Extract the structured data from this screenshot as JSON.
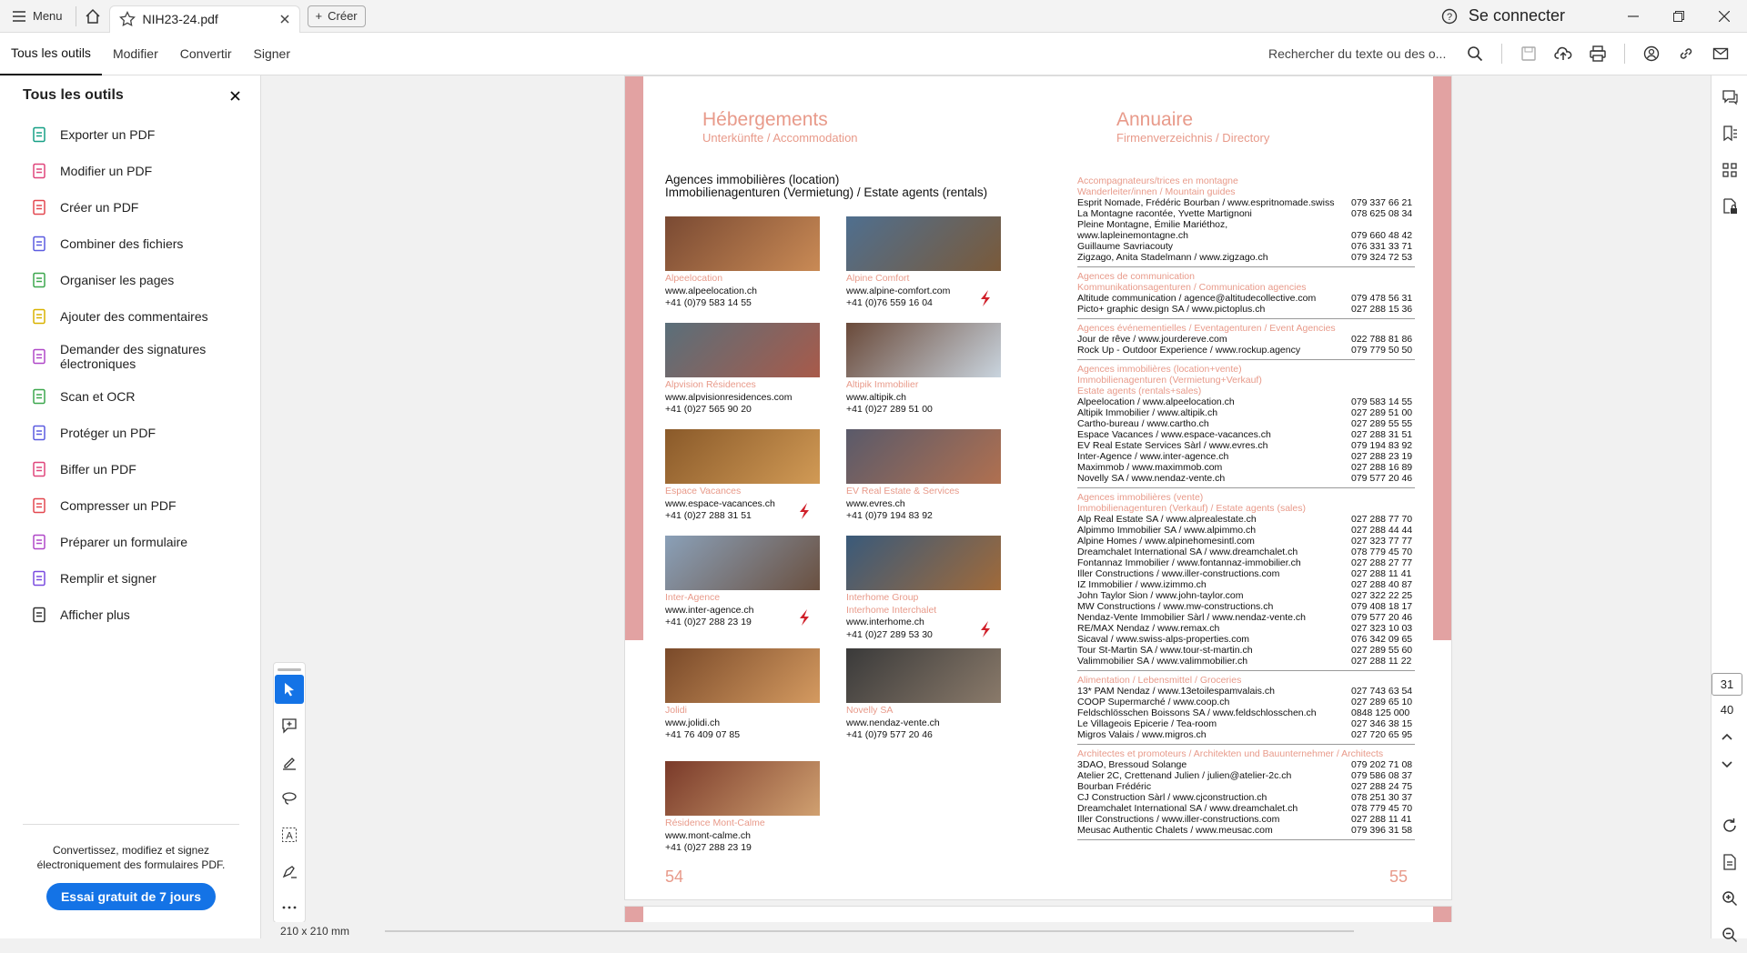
{
  "titlebar": {
    "menu_label": "Menu",
    "tab_title": "NIH23-24.pdf",
    "create_label": "Créer",
    "signin_label": "Se connecter"
  },
  "toolbar": {
    "tabs": [
      "Tous les outils",
      "Modifier",
      "Convertir",
      "Signer"
    ],
    "search_text": "Rechercher du texte ou des o..."
  },
  "left_panel": {
    "title": "Tous les outils",
    "items": [
      {
        "label": "Exporter un PDF",
        "icon": "export-pdf-icon",
        "color": "#17a086"
      },
      {
        "label": "Modifier un PDF",
        "icon": "edit-pdf-icon",
        "color": "#e0467c"
      },
      {
        "label": "Créer un PDF",
        "icon": "create-pdf-icon",
        "color": "#e34850"
      },
      {
        "label": "Combiner des fichiers",
        "icon": "combine-icon",
        "color": "#5c5ce0"
      },
      {
        "label": "Organiser les pages",
        "icon": "organize-icon",
        "color": "#3da74e"
      },
      {
        "label": "Ajouter des commentaires",
        "icon": "comment-icon",
        "color": "#d9b200"
      },
      {
        "label": "Demander des signatures électroniques",
        "icon": "signature-request-icon",
        "color": "#b048c8"
      },
      {
        "label": "Scan et OCR",
        "icon": "scan-icon",
        "color": "#3da74e"
      },
      {
        "label": "Protéger un PDF",
        "icon": "protect-icon",
        "color": "#5c5ce0"
      },
      {
        "label": "Biffer un PDF",
        "icon": "redact-icon",
        "color": "#e0467c"
      },
      {
        "label": "Compresser un PDF",
        "icon": "compress-icon",
        "color": "#e34850"
      },
      {
        "label": "Préparer un formulaire",
        "icon": "form-icon",
        "color": "#b048c8"
      },
      {
        "label": "Remplir et signer",
        "icon": "fill-sign-icon",
        "color": "#7a4be0"
      },
      {
        "label": "Afficher plus",
        "icon": "wrench-icon",
        "color": "#333333"
      }
    ],
    "footer_text": "Convertissez, modifiez et signez électroniquement des formulaires PDF.",
    "trial_button": "Essai gratuit de 7 jours"
  },
  "document": {
    "left_title": "Hébergements",
    "left_subtitle": "Unterkünfte / Accommodation",
    "right_title": "Annuaire",
    "right_subtitle": "Firmenverzeichnis / Directory",
    "section_heading_1": "Agences immobilières (location)",
    "section_heading_2": "Immobilienagenturen (Vermietung) / Estate agents (rentals)",
    "properties": [
      {
        "name": "Alpeelocation",
        "web": "www.alpeelocation.ch",
        "phone": "+41 (0)79 583 14 55",
        "logo": false
      },
      {
        "name": "Alpine Comfort",
        "web": "www.alpine-comfort.com",
        "phone": "+41 (0)76 559 16 04",
        "logo": true
      },
      {
        "name": "Alpvision Résidences",
        "web": "www.alpvisionresidences.com",
        "phone": "+41 (0)27 565 90 20",
        "logo": false
      },
      {
        "name": "Altipik Immobilier",
        "web": "www.altipik.ch",
        "phone": "+41 (0)27 289 51 00",
        "logo": false
      },
      {
        "name": "Espace Vacances",
        "web": "www.espace-vacances.ch",
        "phone": "+41 (0)27 288 31 51",
        "logo": true
      },
      {
        "name": "EV Real Estate & Services",
        "web": "www.evres.ch",
        "phone": "+41 (0)79 194 83 92",
        "logo": false
      },
      {
        "name": "Inter-Agence",
        "web": "www.inter-agence.ch",
        "phone": "+41 (0)27 288 23 19",
        "logo": true
      },
      {
        "name": "Interhome Group\nInterhome Interchalet",
        "web": "www.interhome.ch",
        "phone": "+41 (0)27 289 53 30",
        "logo": true
      },
      {
        "name": "Jolidi",
        "web": "www.jolidi.ch",
        "phone": "+41 76 409 07 85",
        "logo": false
      },
      {
        "name": "Novelly SA",
        "web": "www.nendaz-vente.ch",
        "phone": "+41 (0)79 577 20 46",
        "logo": false
      },
      {
        "name": "Résidence Mont-Calme",
        "web": "www.mont-calme.ch",
        "phone": "+41 (0)27 288 23 19",
        "logo": false
      }
    ],
    "directory": [
      {
        "head": [
          "Accompagnateurs/trices en montagne",
          "Wanderleiter/innen / Mountain guides"
        ],
        "rows": [
          [
            "Esprit Nomade, Frédéric Bourban / www.espritnomade.swiss",
            "079 337 66 21"
          ],
          [
            "La Montagne racontée, Yvette Martignoni",
            "078 625 08 34"
          ],
          [
            "Pleine Montagne, Émilie Mariéthoz,",
            ""
          ],
          [
            "  www.lapleinemontagne.ch",
            "079 660 48 42"
          ],
          [
            "Guillaume Savriacouty",
            "076 331 33 71"
          ],
          [
            "Zigzago, Anita Stadelmann / www.zigzago.ch",
            "079 324 72 53"
          ]
        ]
      },
      {
        "head": [
          "Agences de communication",
          "Kommunikationsagenturen / Communication agencies"
        ],
        "rows": [
          [
            "Altitude communication / agence@altitudecollective.com",
            "079 478 56 31"
          ],
          [
            "Picto+ graphic design SA / www.pictoplus.ch",
            "027 288 15 36"
          ]
        ]
      },
      {
        "head": [
          "Agences événementielles / Eventagenturen / Event Agencies"
        ],
        "rows": [
          [
            "Jour de rêve / www.jourdereve.com",
            "022 788 81 86"
          ],
          [
            "Rock Up - Outdoor Experience / www.rockup.agency",
            "079 779 50 50"
          ]
        ]
      },
      {
        "head": [
          "Agences immobilières (location+vente)",
          "Immobilienagenturen (Vermietung+Verkauf)",
          "Estate agents (rentals+sales)"
        ],
        "rows": [
          [
            "Alpeelocation / www.alpeelocation.ch",
            "079 583 14 55"
          ],
          [
            "Altipik Immobilier / www.altipik.ch",
            "027 289 51 00"
          ],
          [
            "Cartho-bureau / www.cartho.ch",
            "027 289 55 55"
          ],
          [
            "Espace Vacances / www.espace-vacances.ch",
            "027 288 31 51"
          ],
          [
            "EV Real Estate Services Sàrl / www.evres.ch",
            "079 194 83 92"
          ],
          [
            "Inter-Agence / www.inter-agence.ch",
            "027 288 23 19"
          ],
          [
            "Maximmob / www.maximmob.com",
            "027 288 16 89"
          ],
          [
            "Novelly SA / www.nendaz-vente.ch",
            "079 577 20 46"
          ]
        ]
      },
      {
        "head": [
          "Agences immobilières (vente)",
          "Immobilienagenturen (Verkauf) / Estate agents (sales)"
        ],
        "rows": [
          [
            "Alp Real Estate SA / www.alprealestate.ch",
            "027 288 77 70"
          ],
          [
            "Alpimmo Immobilier SA / www.alpimmo.ch",
            "027 288 44 44"
          ],
          [
            "Alpine Homes / www.alpinehomesintl.com",
            "027 323 77 77"
          ],
          [
            "Dreamchalet International SA / www.dreamchalet.ch",
            "078 779 45 70"
          ],
          [
            "Fontannaz Immobilier / www.fontannaz-immobilier.ch",
            "027 288 27 77"
          ],
          [
            "Iller Constructions / www.iller-constructions.com",
            "027 288 11 41"
          ],
          [
            "IZ Immobilier / www.izimmo.ch",
            "027 288 40 87"
          ],
          [
            "John Taylor Sion / www.john-taylor.com",
            "027 322 22 25"
          ],
          [
            "MW Constructions / www.mw-constructions.ch",
            "079 408 18 17"
          ],
          [
            "Nendaz-Vente Immobilier Sàrl / www.nendaz-vente.ch",
            "079 577 20 46"
          ],
          [
            "RE/MAX Nendaz / www.remax.ch",
            "027 323 10 03"
          ],
          [
            "Sicaval / www.swiss-alps-properties.com",
            "076 342 09 65"
          ],
          [
            "Tour St-Martin SA / www.tour-st-martin.ch",
            "027 289 55 60"
          ],
          [
            "Valimmobilier SA / www.valimmobilier.ch",
            "027 288 11 22"
          ]
        ]
      },
      {
        "head": [
          "Alimentation / Lebensmittel / Groceries"
        ],
        "rows": [
          [
            "13* PAM Nendaz / www.13etoilespamvalais.ch",
            "027 743 63 54"
          ],
          [
            "COOP Supermarché / www.coop.ch",
            "027 289 65 10"
          ],
          [
            "Feldschlösschen Boissons SA / www.feldschlosschen.ch",
            "0848 125 000"
          ],
          [
            "Le Villageois Epicerie / Tea-room",
            "027 346 38 15"
          ],
          [
            "Migros Valais / www.migros.ch",
            "027 720 65 95"
          ]
        ]
      },
      {
        "head": [
          "Architectes et promoteurs / Architekten und Bauunternehmer  /  Architects"
        ],
        "rows": [
          [
            "3DAO, Bressoud Solange",
            "079 202 71 08"
          ],
          [
            "Atelier 2C, Crettenand Julien / julien@atelier-2c.ch",
            "079 586 08 37"
          ],
          [
            "Bourban Frédéric",
            "027 288 24 75"
          ],
          [
            "CJ Construction Sàrl / www.cjconstruction.ch",
            "078 251 30 37"
          ],
          [
            "Dreamchalet International SA / www.dreamchalet.ch",
            "078 779 45 70"
          ],
          [
            "Iller Constructions / www.iller-constructions.com",
            "027 288 11 41"
          ],
          [
            "Meusac Authentic Chalets / www.meusac.com",
            "079 396 31 58"
          ]
        ]
      }
    ],
    "page_left": "54",
    "page_right": "55"
  },
  "statusbar": {
    "page_size": "210 x 210 mm"
  },
  "page_nav": {
    "current": "31",
    "total": "40"
  }
}
